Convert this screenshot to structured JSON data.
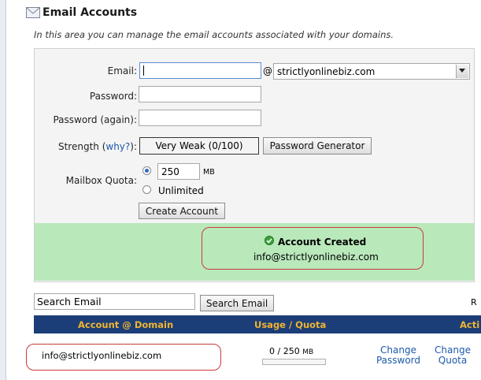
{
  "header": {
    "title": "Email Accounts",
    "description": "In this area you can manage the email accounts associated with your domains."
  },
  "form": {
    "email_label": "Email:",
    "email_value": "",
    "at_symbol": "@",
    "domain_selected": "strictlyonlinebiz.com",
    "password_label": "Password:",
    "password_again_label": "Password (again):",
    "strength_label": "Strength (",
    "strength_why": "why?",
    "strength_close": "):",
    "strength_value": "Very Weak (0/100)",
    "password_generator_label": "Password Generator",
    "quota_label": "Mailbox Quota:",
    "quota_value": "250",
    "quota_unit": "MB",
    "unlimited_label": "Unlimited",
    "create_button_label": "Create Account"
  },
  "status": {
    "title": "Account Created",
    "email": "info@strictlyonlinebiz.com"
  },
  "search": {
    "placeholder": "Search Email",
    "button_label": "Search Email",
    "right_cut_label": "R"
  },
  "table": {
    "columns": [
      "Account @ Domain",
      "Usage / Quota",
      "Acti"
    ],
    "rows": [
      {
        "account": "info@strictlyonlinebiz.com",
        "usage": "0 / 250",
        "usage_unit": "MB",
        "usage_fraction": 0,
        "change_password": [
          "Change",
          "Password"
        ],
        "change_quota": [
          "Change",
          "Quota"
        ]
      }
    ]
  },
  "colors": {
    "success_bg": "#b9e8bb",
    "table_header_bg": "#1c3e78",
    "table_header_text": "#f0b431",
    "link": "#1d5aa8",
    "highlight_outline": "#cc3a3a"
  }
}
